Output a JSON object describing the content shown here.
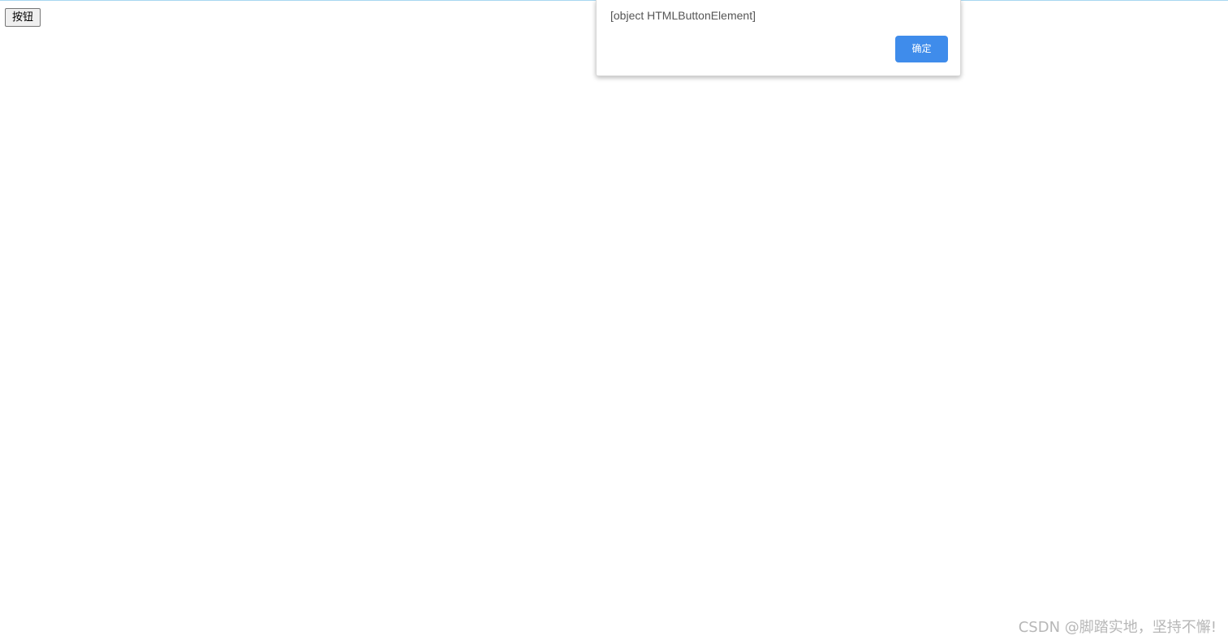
{
  "page": {
    "button_label": "按钮"
  },
  "alert": {
    "message": "[object HTMLButtonElement]",
    "ok_label": "确定"
  },
  "watermark": {
    "text": "CSDN @脚踏实地，坚持不懈!"
  },
  "colors": {
    "accent": "#3f8ceb",
    "top_border": "#a8d7f0"
  }
}
